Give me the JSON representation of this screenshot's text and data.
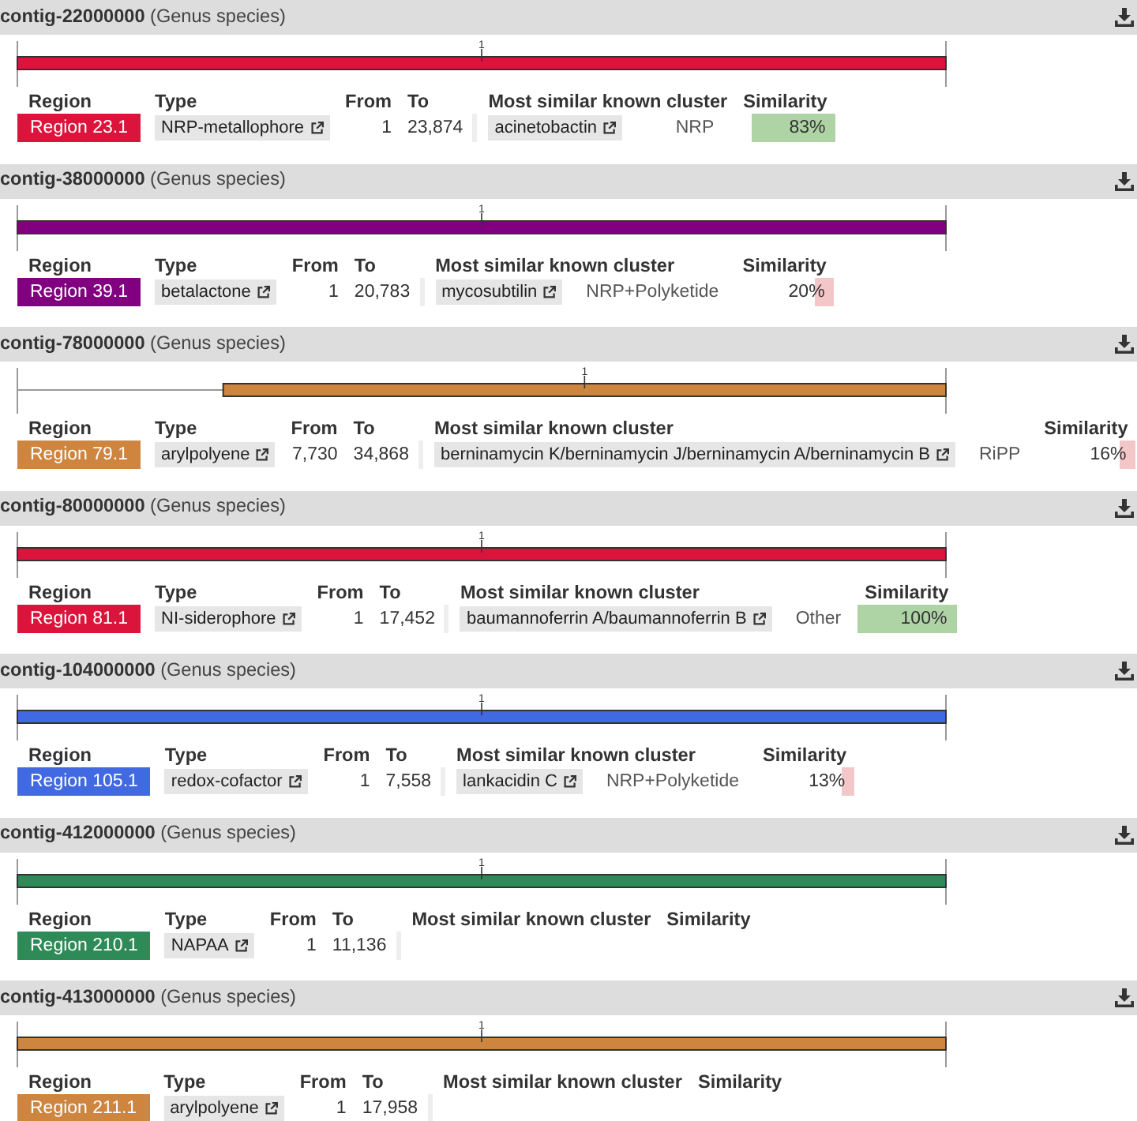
{
  "contigs": [
    {
      "name": "contig-22000000",
      "organism": "(Genus species)",
      "track_label": "1",
      "headers": [
        "Region",
        "Type",
        "From",
        "To",
        "Most similar known cluster",
        "Similarity"
      ],
      "region": {
        "label": "Region 23.1",
        "color": "#dc143c",
        "type": "NRP-metallophore",
        "from": "1",
        "to": "23,874",
        "most_similar": "acinetobactin",
        "cluster_type": "NRP",
        "similarity": "83%",
        "level": 0.83
      }
    },
    {
      "name": "contig-38000000",
      "organism": "(Genus species)",
      "track_label": "1",
      "headers": [
        "Region",
        "Type",
        "From",
        "To",
        "Most similar known cluster",
        "Similarity"
      ],
      "region": {
        "label": "Region 39.1",
        "color": "#800080",
        "type": "betalactone",
        "from": "1",
        "to": "20,783",
        "most_similar": "mycosubtilin",
        "cluster_type": "NRP+Polyketide",
        "similarity": "20%",
        "level": 0.2
      }
    },
    {
      "name": "contig-78000000",
      "organism": "(Genus species)",
      "track_label": "1",
      "headers": [
        "Region",
        "Type",
        "From",
        "To",
        "Most similar known cluster",
        "Similarity"
      ],
      "region": {
        "label": "Region 79.1",
        "color": "#cd853f",
        "type": "arylpolyene",
        "from": "7,730",
        "to": "34,868",
        "most_similar": "berninamycin K/berninamycin J/berninamycin A/berninamycin B",
        "cluster_type": "RiPP",
        "similarity": "16%",
        "level": 0.16
      }
    },
    {
      "name": "contig-80000000",
      "organism": "(Genus species)",
      "track_label": "1",
      "headers": [
        "Region",
        "Type",
        "From",
        "To",
        "Most similar known cluster",
        "Similarity"
      ],
      "region": {
        "label": "Region 81.1",
        "color": "#dc143c",
        "type": "NI-siderophore",
        "from": "1",
        "to": "17,452",
        "most_similar": "baumannoferrin A/baumannoferrin B",
        "cluster_type": "Other",
        "similarity": "100%",
        "level": 1.0
      }
    },
    {
      "name": "contig-104000000",
      "organism": "(Genus species)",
      "track_label": "1",
      "headers": [
        "Region",
        "Type",
        "From",
        "To",
        "Most similar known cluster",
        "Similarity"
      ],
      "region": {
        "label": "Region 105.1",
        "color": "#4169e1",
        "type": "redox-cofactor",
        "from": "1",
        "to": "7,558",
        "most_similar": "lankacidin C",
        "cluster_type": "NRP+Polyketide",
        "similarity": "13%",
        "level": 0.13
      }
    },
    {
      "name": "contig-412000000",
      "organism": "(Genus species)",
      "track_label": "1",
      "headers": [
        "Region",
        "Type",
        "From",
        "To",
        "Most similar known cluster",
        "Similarity"
      ],
      "region": {
        "label": "Region 210.1",
        "color": "#2e8b57",
        "type": "NAPAA",
        "from": "1",
        "to": "11,136"
      }
    },
    {
      "name": "contig-413000000",
      "organism": "(Genus species)",
      "track_label": "1",
      "headers": [
        "Region",
        "Type",
        "From",
        "To",
        "Most similar known cluster",
        "Similarity"
      ],
      "region": {
        "label": "Region 211.1",
        "color": "#cd853f",
        "type": "arylpolyene",
        "from": "1",
        "to": "17,958"
      }
    }
  ]
}
